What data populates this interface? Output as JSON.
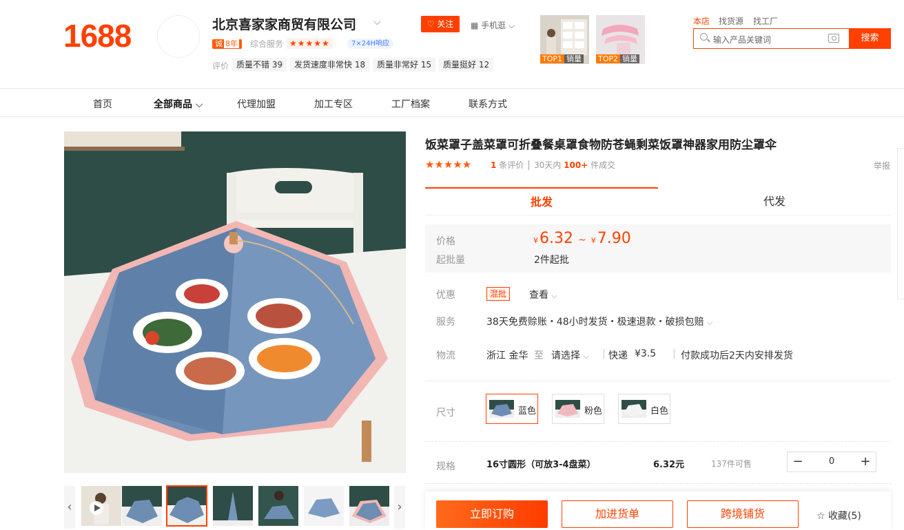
{
  "header": {
    "logo": "1688",
    "shop_name": "北京喜家家商贸有限公司",
    "years_prefix": "诚",
    "years": "8年",
    "service_label": "综合服务",
    "service_stars": "★★★★★",
    "response_badge": "7×24H响应",
    "eval_label": "评价",
    "eval_tags": [
      {
        "name": "质量不错",
        "count": "39"
      },
      {
        "name": "发货速度非常快",
        "count": "18"
      },
      {
        "name": "质量非常好",
        "count": "15"
      },
      {
        "name": "质量挺好",
        "count": "12"
      }
    ],
    "follow_label": "关注",
    "mobile_label": "手机逛",
    "top_cards": [
      {
        "rank": "TOP1",
        "label": "销量"
      },
      {
        "rank": "TOP2",
        "label": "销量"
      }
    ],
    "search_scopes": [
      "本店",
      "找货源",
      "找工厂"
    ],
    "search_placeholder": "输入产品关键词",
    "search_button": "搜索"
  },
  "nav": {
    "items": [
      "首页",
      "全部商品",
      "代理加盟",
      "加工专区",
      "工厂档案",
      "联系方式"
    ]
  },
  "product": {
    "title": "饭菜罩子盖菜罩可折叠餐桌罩食物防苍蝇剩菜饭罩神器家用防尘罩伞",
    "stars": "★★★★★",
    "review_count": "1",
    "review_suffix": "条评价",
    "sales_prefix": "30天内",
    "sales_count": "100+",
    "sales_suffix": "件成交",
    "report_label": "举报",
    "tabs": [
      "批发",
      "代发"
    ],
    "price_label": "价格",
    "currency": "¥",
    "price_min": "6.32",
    "price_sep": "~",
    "price_max": "7.90",
    "moq_label": "起批量",
    "moq_value": "2件起批",
    "promo_label": "优惠",
    "promo_tag": "混批",
    "promo_view": "查看",
    "service_label": "服务",
    "service_value": "38天免费赊账・48小时发货・极速退款・破损包赔",
    "logistics_label": "物流",
    "ship_from": "浙江 金华",
    "ship_to_label": "至",
    "ship_to_select": "请选择",
    "express_label": "快递",
    "express_fee": "¥3.5",
    "ship_note": "付款成功后2天内安排发货",
    "size_label": "尺寸",
    "sizes": [
      "蓝色",
      "粉色",
      "白色"
    ],
    "spec_label": "规格",
    "spec_name": "16寸圆形（可放3-4盘菜）",
    "spec_price": "6.32元",
    "spec_stock": "137件可售",
    "quantity": "0",
    "buttons": {
      "order": "立即订购",
      "cart": "加进货单",
      "crossborder": "跨境铺货",
      "favorite": "收藏(5)"
    }
  }
}
